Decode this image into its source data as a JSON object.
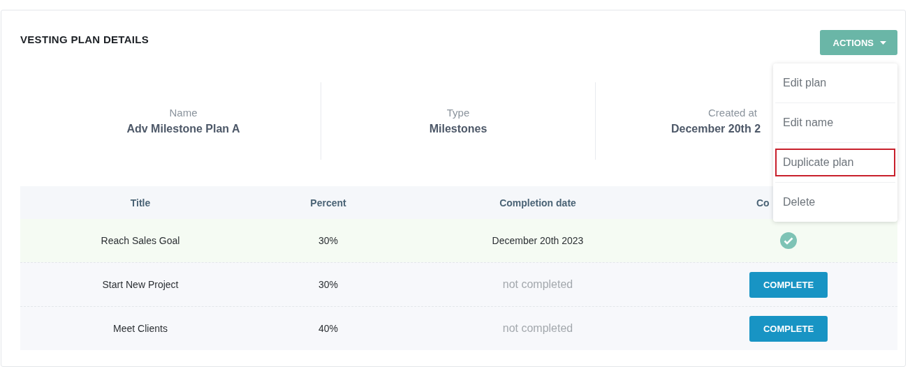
{
  "title": "VESTING PLAN DETAILS",
  "actions_button": {
    "label": "ACTIONS"
  },
  "actions_menu": [
    {
      "label": "Edit plan",
      "highlighted": false
    },
    {
      "label": "Edit name",
      "highlighted": false
    },
    {
      "label": "Duplicate plan",
      "highlighted": true
    },
    {
      "label": "Delete",
      "highlighted": false
    }
  ],
  "details": [
    {
      "label": "Name",
      "value": "Adv Milestone Plan A"
    },
    {
      "label": "Type",
      "value": "Milestones"
    },
    {
      "label": "Created at",
      "value": "December 20th 2"
    }
  ],
  "table": {
    "columns": [
      "Title",
      "Percent",
      "Completion date",
      "Co"
    ],
    "rows": [
      {
        "title": "Reach Sales Goal",
        "percent": "30%",
        "completion_date": "December 20th 2023",
        "completed": true
      },
      {
        "title": "Start New Project",
        "percent": "30%",
        "completion_date": "not completed",
        "completed": false,
        "button": "COMPLETE"
      },
      {
        "title": "Meet Clients",
        "percent": "40%",
        "completion_date": "not completed",
        "completed": false,
        "button": "COMPLETE"
      }
    ]
  }
}
